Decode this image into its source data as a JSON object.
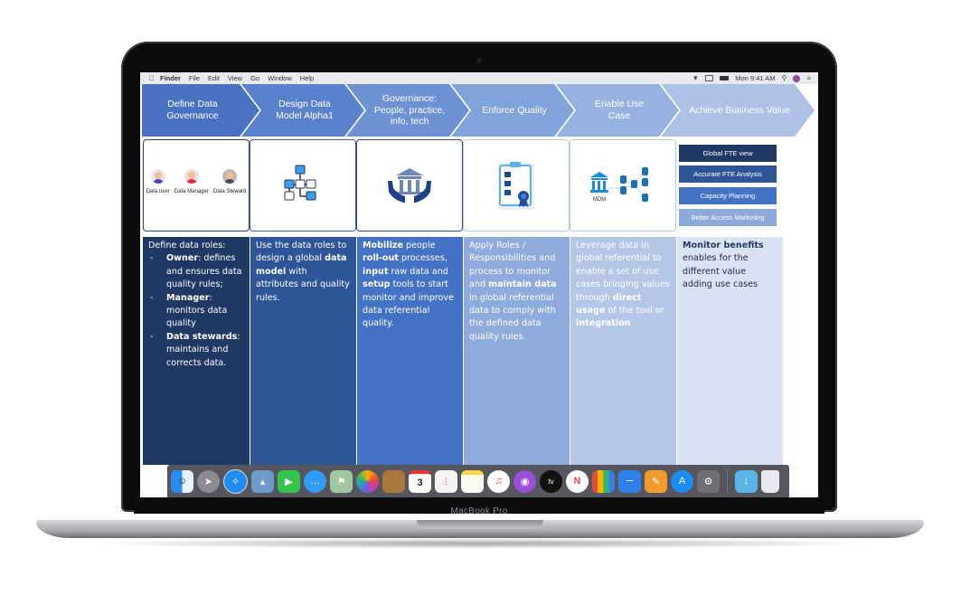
{
  "device": {
    "label": "MacBook Pro"
  },
  "menubar": {
    "apple_icon": "",
    "items": [
      "Finder",
      "File",
      "Edit",
      "View",
      "Go",
      "Window",
      "Help"
    ],
    "clock": "Mon 9:41 AM",
    "status_icons": [
      "wifi-icon",
      "airplay-icon",
      "battery-icon",
      "search-icon",
      "siri-icon",
      "control-center-icon"
    ]
  },
  "process_steps": [
    {
      "label": "Define Data Governance"
    },
    {
      "label": "Design Data Model Alpha1"
    },
    {
      "label": "Governance: People, practice, info, tech"
    },
    {
      "label": "Enforce Quality"
    },
    {
      "label": "Enable Use Case"
    },
    {
      "label": "Achieve Business Value"
    }
  ],
  "roles": [
    {
      "label": "Data user"
    },
    {
      "label": "Data Manager"
    },
    {
      "label": "Data Steward"
    }
  ],
  "mdm_label": "MDM",
  "benefits": [
    {
      "label": "Global FTE view",
      "color": "#1f3864"
    },
    {
      "label": "Accurate FTE Analysis",
      "color": "#2e5597"
    },
    {
      "label": "Capacity Planning",
      "color": "#4472c4"
    },
    {
      "label": "Better Access Marketing",
      "color": "#8eaadb"
    }
  ],
  "descriptions": {
    "col1": {
      "intro": "Define data roles:",
      "items": [
        {
          "bold": "Owner",
          "text": ": defines and ensures data quality rules;"
        },
        {
          "bold": "Manager",
          "text": ": monitors data quality"
        },
        {
          "bold": "Data stewards",
          "text": ": maintains and corrects data."
        }
      ]
    },
    "col2": {
      "t1": "Use the data roles to design a global ",
      "b1": "data model",
      "t2": " with attributes and quality rules."
    },
    "col3": {
      "b1": "Mobilize",
      "t1": " people ",
      "b2": "roll-out",
      "t2": " processes, ",
      "b3": "input",
      "t3": " raw data and ",
      "b4": "setup",
      "t4": " tools to start monitor and improve data referential quality."
    },
    "col4": {
      "t1": "Apply Roles / Responsibilities and process to monitor and ",
      "b1": "maintain data",
      "t2": " in global referential data to comply with the defined data quality rules."
    },
    "col5": {
      "t1": "Leverage data in global referential to enable a set of use cases bringing values through ",
      "b1": "direct usage",
      "t2": " of the tool or ",
      "b2": "integration"
    },
    "col6": {
      "b1": "Monitor benefits",
      "t1": " enables for the different value adding use cases"
    }
  },
  "colors": {
    "col1": "#1f3864",
    "col2": "#2e5597",
    "col3": "#4472c4",
    "col4": "#8faadc",
    "col5": "#b4c7e7",
    "col6": "#dae3f3",
    "chevrons": [
      "#4a72c2",
      "#5a82cc",
      "#6d91d3",
      "#82a2da",
      "#97b2e0",
      "#adc2e6"
    ]
  },
  "dock": {
    "apps": [
      "Finder",
      "Launchpad",
      "Safari",
      "Preview",
      "FaceTime",
      "Messages",
      "Maps",
      "Photos",
      "Contacts",
      "Calendar",
      "Reminders",
      "Notes",
      "Music",
      "Podcasts",
      "TV",
      "News",
      "Numbers",
      "Keynote",
      "Pages",
      "App Store",
      "System Preferences"
    ],
    "calendar_day": "3",
    "tv_label": "tv",
    "right": [
      "Downloads",
      "Trash"
    ]
  }
}
